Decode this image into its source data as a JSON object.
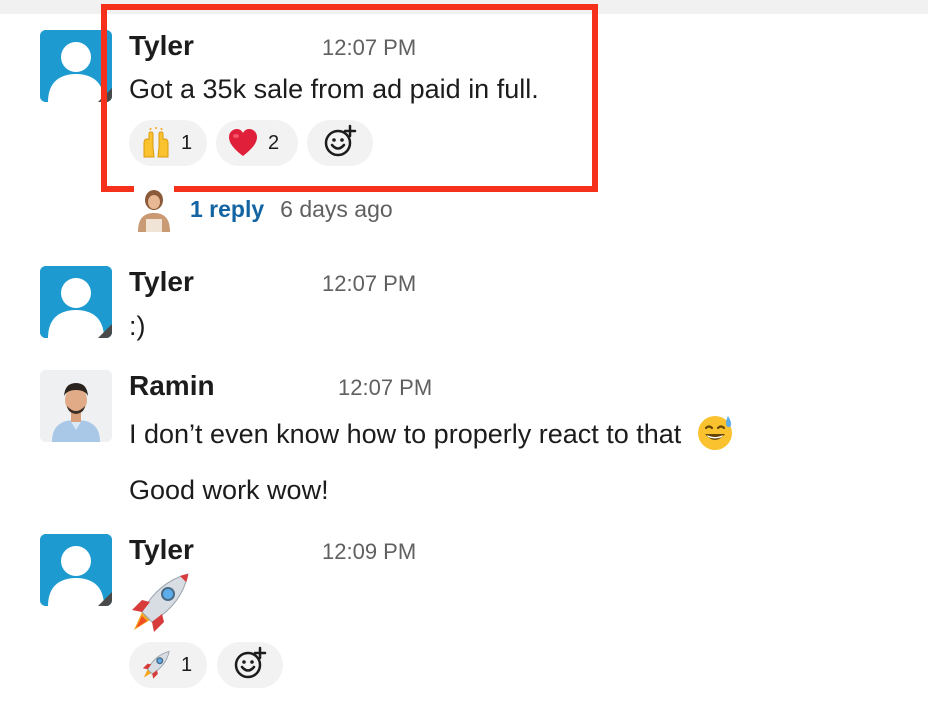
{
  "messages": [
    {
      "author": "Tyler",
      "time": "12:07 PM",
      "text": "Got a 35k sale from ad paid in full.",
      "reactions": [
        {
          "emoji": "raised-hands",
          "count": "1"
        },
        {
          "emoji": "red-heart",
          "count": "2"
        }
      ],
      "thread": {
        "replies": "1 reply",
        "last_reply": "6 days ago"
      }
    },
    {
      "author": "Tyler",
      "time": "12:07 PM",
      "text": ":)"
    },
    {
      "author": "Ramin",
      "time": "12:07 PM",
      "text": "I don’t even know how to properly react to that",
      "text2": "Good work wow!"
    },
    {
      "author": "Tyler",
      "time": "12:09 PM",
      "text": "rocket",
      "reactions": [
        {
          "emoji": "rocket",
          "count": "1"
        }
      ]
    }
  ],
  "colors": {
    "highlight": "#f5311b",
    "link": "#1264a3",
    "avatar_bg": "#1d9bd1"
  }
}
